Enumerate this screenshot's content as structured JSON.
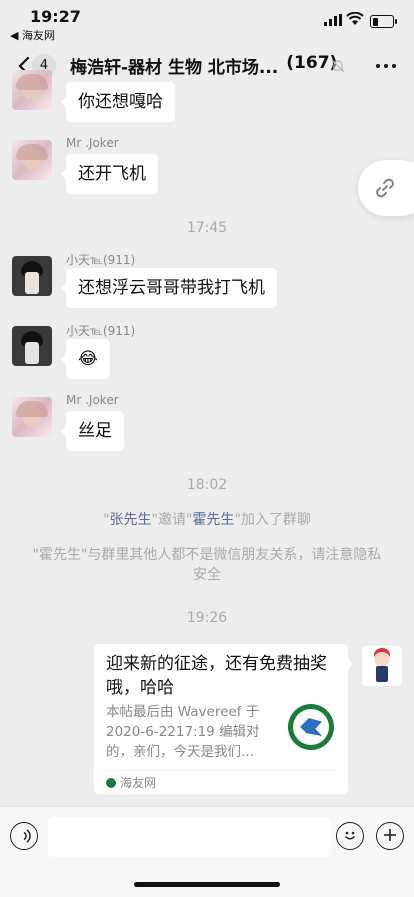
{
  "status_bar": {
    "time": "19:27",
    "back_to_app": "◀ 海友网",
    "battery_level": 0.3
  },
  "header": {
    "unread_count": "4",
    "title": "梅浩轩-器材 生物 北市场...",
    "member_count": "(167)"
  },
  "messages": [
    {
      "sender": "",
      "text": "你还想嘎哈"
    },
    {
      "sender": "Mr .Joker",
      "text": "还开飞机"
    },
    {
      "timestamp": "17:45"
    },
    {
      "sender": "小天℡(911)",
      "text": "还想浮云哥哥带我打飞机"
    },
    {
      "sender": "小天℡(911)",
      "text": "😂"
    },
    {
      "sender": "Mr .Joker",
      "text": "丝足"
    },
    {
      "timestamp": "18:02"
    },
    {
      "system_a": {
        "q1": "\"",
        "name1": "张先生",
        "mid": "\"邀请\"",
        "name2": "霍先生",
        "end": "\"加入了群聊"
      }
    },
    {
      "system_b": "\"霍先生\"与群里其他人都不是微信朋友关系，请注意隐私安全"
    },
    {
      "timestamp": "19:26"
    }
  ],
  "card": {
    "title": "迎来新的征途，还有免费抽奖哦，哈哈",
    "description": "本帖最后由 Wavereef 于 2020-6-2217:19 编辑对的，亲们，今天是我们...",
    "source": "海友网"
  }
}
